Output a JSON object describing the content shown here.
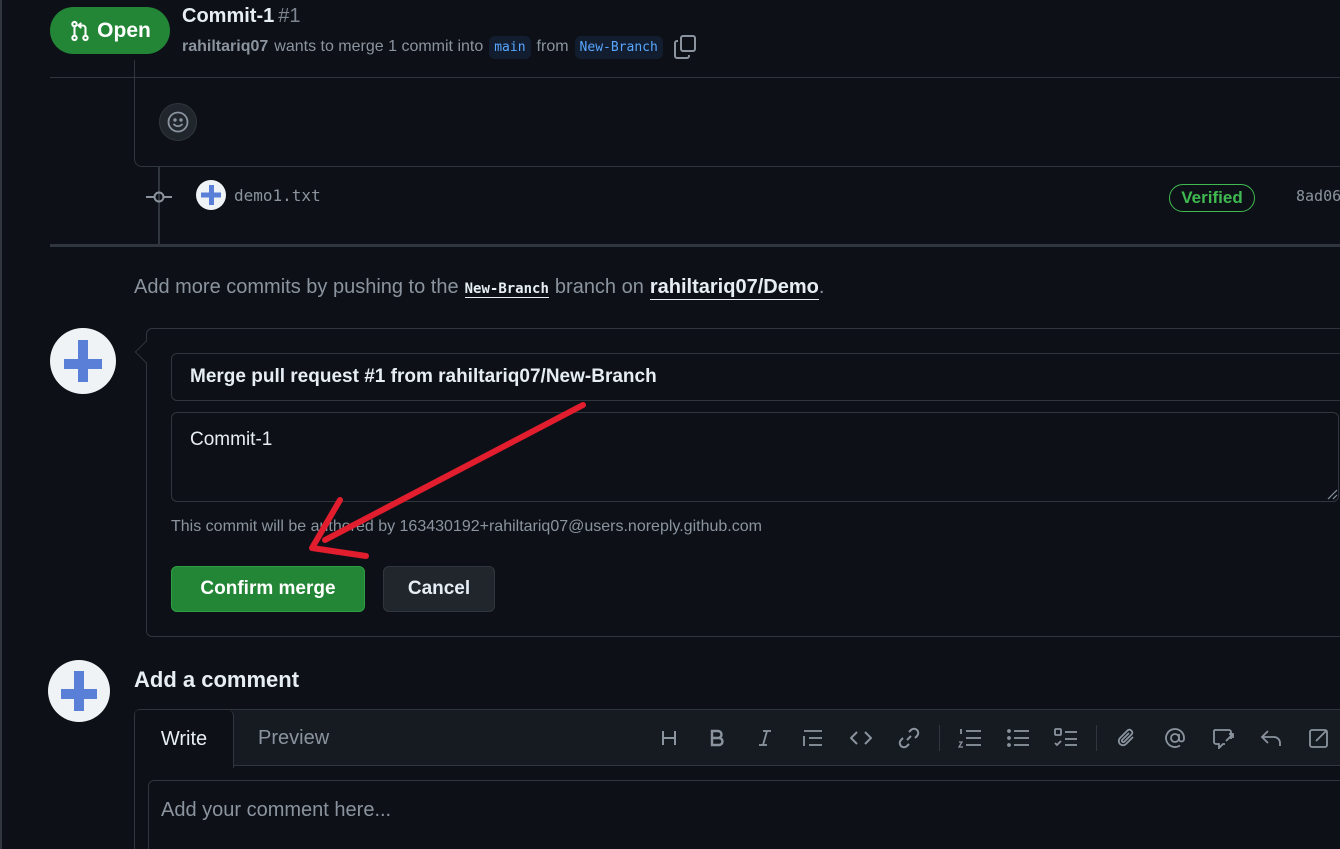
{
  "header": {
    "status": "Open",
    "title": "Commit-1",
    "number": "#1",
    "author": "rahiltariq07",
    "wants_to_merge": "wants to merge 1 commit into",
    "base_branch": "main",
    "from_word": "from",
    "head_branch": "New-Branch"
  },
  "commit": {
    "file": "demo1.txt",
    "verified_label": "Verified",
    "sha": "8ad06"
  },
  "hint": {
    "prefix": "Add more commits by pushing to the",
    "branch": "New-Branch",
    "middle": "branch on",
    "repo": "rahiltariq07/Demo",
    "suffix": "."
  },
  "merge": {
    "title_value": "Merge pull request #1 from rahiltariq07/New-Branch",
    "message_value": "Commit-1",
    "author_note": "This commit will be authored by 163430192+rahiltariq07@users.noreply.github.com",
    "confirm_label": "Confirm merge",
    "cancel_label": "Cancel"
  },
  "comment": {
    "heading": "Add a comment",
    "tab_write": "Write",
    "tab_preview": "Preview",
    "placeholder": "Add your comment here...",
    "toolbar_icons": [
      "heading-icon",
      "bold-icon",
      "italic-icon",
      "quote-icon",
      "code-icon",
      "link-icon",
      "ordered-list-icon",
      "unordered-list-icon",
      "task-list-icon",
      "attach-icon",
      "mention-icon",
      "reference-icon",
      "undo-icon",
      "fullscreen-icon"
    ]
  },
  "colors": {
    "background": "#0d1117",
    "border": "#30363d",
    "green": "#238636",
    "accent_blue": "#58a6ff",
    "annotation_red": "#e11d2e"
  }
}
